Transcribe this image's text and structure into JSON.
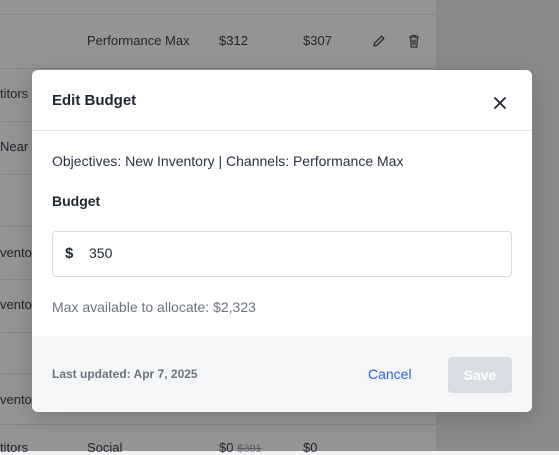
{
  "background": {
    "row1": {
      "channel": "Performance Max",
      "budget": "$312",
      "spend": "$307"
    },
    "fragments": [
      "titors",
      "Near M",
      "ventor",
      "ventor",
      "ventor"
    ],
    "last_row": {
      "name": "titors",
      "channel": "Social",
      "budget": "$0",
      "prev": "$301",
      "spend": "$0"
    }
  },
  "modal": {
    "title": "Edit Budget",
    "subtitle": "Objectives: New Inventory | Channels: Performance Max",
    "budget_label": "Budget",
    "currency_symbol": "$",
    "budget_value": "350",
    "max_note": "Max available to allocate: $2,323",
    "last_updated": "Last updated: Apr 7, 2025",
    "cancel_label": "Cancel",
    "save_label": "Save"
  },
  "colors": {
    "accent": "#2a66d8",
    "save_disabled": "#d8dce3"
  }
}
